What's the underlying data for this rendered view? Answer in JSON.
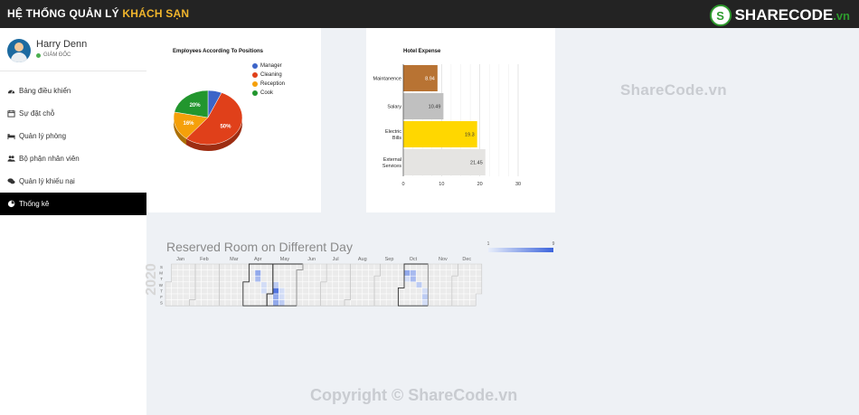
{
  "header": {
    "title_prefix": "HỆ THỐNG QUẢN LÝ ",
    "title_accent": "KHÁCH SẠN",
    "logo_text": "SHARECODE",
    "logo_suffix": ".vn"
  },
  "user": {
    "name": "Harry Denn",
    "role": "GIÁM ĐỐC"
  },
  "sidebar": {
    "items": [
      {
        "label": "Bảng điều khiển",
        "icon": "dashboard-icon"
      },
      {
        "label": "Sự đặt chỗ",
        "icon": "calendar-icon"
      },
      {
        "label": "Quản lý phòng",
        "icon": "bed-icon"
      },
      {
        "label": "Bộ phận nhân viên",
        "icon": "users-icon"
      },
      {
        "label": "Quản lý khiếu nại",
        "icon": "comments-icon"
      },
      {
        "label": "Thống kê",
        "icon": "pie-chart-icon",
        "active": true
      }
    ]
  },
  "watermark": {
    "top": "ShareCode.vn",
    "bottom": "Copyright © ShareCode.vn"
  },
  "chart_data": [
    {
      "type": "pie",
      "title": "Employees According To Positions",
      "legend_position": "right",
      "slices": [
        {
          "label": "Manager",
          "value": 6,
          "color": "#3c64c8",
          "label_text": ""
        },
        {
          "label": "Cleaning",
          "value": 50,
          "color": "#e0401a",
          "label_text": "50%"
        },
        {
          "label": "Reception",
          "value": 16,
          "color": "#f5a00a",
          "label_text": "16%"
        },
        {
          "label": "Cook",
          "value": 20,
          "color": "#22962e",
          "label_text": "20%"
        }
      ]
    },
    {
      "type": "bar",
      "orientation": "horizontal",
      "title": "Hotel Expense",
      "categories": [
        "Maintanence",
        "Salary",
        "Electric Bills",
        "External Services"
      ],
      "values": [
        8.94,
        10.49,
        19.3,
        21.45
      ],
      "value_labels": [
        "8.94",
        "10.49",
        "19.3",
        "21.45"
      ],
      "colors": [
        "#b87333",
        "#c0c0c0",
        "#ffd700",
        "#e5e4e2"
      ],
      "xlim": [
        0,
        30
      ],
      "xticks": [
        "0",
        "10",
        "20",
        "30"
      ],
      "grid": true
    },
    {
      "type": "heatmap",
      "title": "Reserved Room on Different Day",
      "year": "2020",
      "months": [
        "Jan",
        "Feb",
        "Mar",
        "Apr",
        "May",
        "Jun",
        "Jul",
        "Aug",
        "Sep",
        "Oct",
        "Nov",
        "Dec"
      ],
      "weekdays": [
        "S",
        "M",
        "T",
        "W",
        "T",
        "F",
        "S"
      ],
      "color_axis": {
        "min": 1,
        "max": 9,
        "min_label": "1",
        "max_label": "9"
      },
      "cells": [
        {
          "date": "2020-04-13",
          "value": 5
        },
        {
          "date": "2020-04-14",
          "value": 4
        },
        {
          "date": "2020-04-22",
          "value": 2
        },
        {
          "date": "2020-04-23",
          "value": 2
        },
        {
          "date": "2020-05-06",
          "value": 3
        },
        {
          "date": "2020-05-07",
          "value": 8
        },
        {
          "date": "2020-05-08",
          "value": 5
        },
        {
          "date": "2020-05-09",
          "value": 5
        },
        {
          "date": "2020-05-14",
          "value": 2
        },
        {
          "date": "2020-05-15",
          "value": 2
        },
        {
          "date": "2020-05-16",
          "value": 3
        },
        {
          "date": "2020-10-05",
          "value": 5
        },
        {
          "date": "2020-10-06",
          "value": 2
        },
        {
          "date": "2020-10-12",
          "value": 4
        },
        {
          "date": "2020-10-13",
          "value": 4
        },
        {
          "date": "2020-10-21",
          "value": 3
        },
        {
          "date": "2020-10-29",
          "value": 2
        },
        {
          "date": "2020-10-30",
          "value": 3
        },
        {
          "date": "2020-10-31",
          "value": 2
        }
      ]
    }
  ]
}
